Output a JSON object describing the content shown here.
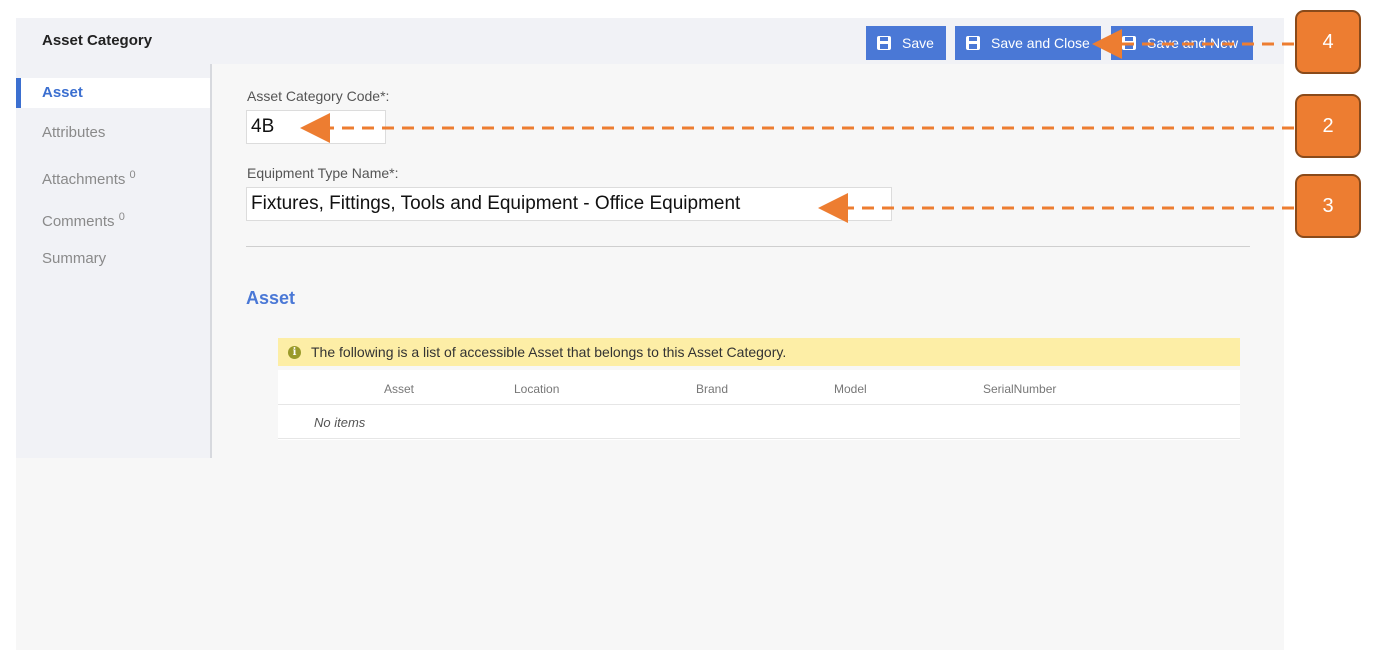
{
  "header": {
    "title": "Asset Category",
    "buttons": {
      "save": "Save",
      "save_close": "Save and Close",
      "save_new": "Save and New"
    }
  },
  "sidebar": {
    "items": [
      {
        "label": "Asset",
        "count": null,
        "active": true
      },
      {
        "label": "Attributes",
        "count": null,
        "active": false
      },
      {
        "label": "Attachments",
        "count": "0",
        "active": false
      },
      {
        "label": "Comments",
        "count": "0",
        "active": false
      },
      {
        "label": "Summary",
        "count": null,
        "active": false
      }
    ]
  },
  "form": {
    "code": {
      "label": "Asset Category Code*:",
      "value": "4B"
    },
    "name": {
      "label": "Equipment Type Name*:",
      "value": "Fixtures, Fittings, Tools and Equipment - Office Equipment"
    }
  },
  "asset_section": {
    "title": "Asset",
    "info": "The following is a list of accessible Asset that belongs to this Asset Category.",
    "columns": [
      "Asset",
      "Location",
      "Brand",
      "Model",
      "SerialNumber"
    ],
    "empty_text": "No items"
  },
  "annotations": {
    "badges": [
      "4",
      "2",
      "3"
    ],
    "color": "#ed7d31"
  }
}
